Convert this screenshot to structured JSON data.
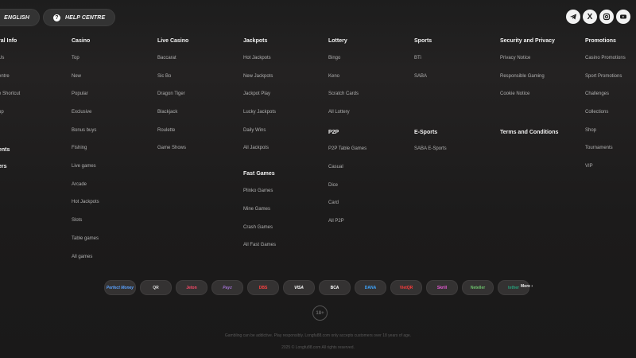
{
  "header": {
    "lang_label": "ENGLISH",
    "help_label": "HELP CENTRE",
    "social": [
      {
        "icon": "telegram-icon",
        "glyph": "➤"
      },
      {
        "icon": "x-icon",
        "glyph": "𝕏"
      },
      {
        "icon": "instagram-icon",
        "glyph": "◎"
      },
      {
        "icon": "youtube-icon",
        "glyph": "▶"
      }
    ]
  },
  "columns": [
    {
      "title": "ral Info",
      "sections": [
        {
          "items": [
            "Us",
            "entre",
            "e Shortcut",
            "op"
          ]
        },
        {
          "items": []
        }
      ],
      "extra_titles": [
        "ents",
        "ers"
      ]
    },
    {
      "title": "Casino",
      "items": [
        "Top",
        "New",
        "Popular",
        "Exclusive",
        "Bonus buys",
        "Fishing",
        "Live games",
        "Arcade",
        "Hot Jackpots",
        "Slots",
        "Table games",
        "All games"
      ]
    },
    {
      "title": "Live Casino",
      "items": [
        "Baccarat",
        "Sic Bo",
        "Dragon Tiger",
        "Blackjack",
        "Roulette",
        "Game Shows"
      ]
    },
    {
      "title": "Jackpots",
      "items": [
        "Hot Jackpots",
        "New Jackpots",
        "Jackpot Play",
        "Lucky Jackpots",
        "Daily Wins",
        "All Jackpots"
      ],
      "title2": "Fast Games",
      "items2": [
        "Plinko Games",
        "Mine Games",
        "Crash Games",
        "All Fast Games"
      ]
    },
    {
      "title": "Lottery",
      "items": [
        "Bingo",
        "Keno",
        "Scratch Cards",
        "All Lottery"
      ],
      "title2": "P2P",
      "items2": [
        "P2P Table Games",
        "Casual",
        "Dice",
        "Card",
        "All P2P"
      ]
    },
    {
      "title": "Sports",
      "items": [
        "BTi",
        "SABA"
      ],
      "title2": "E-Sports",
      "items2": [
        "SABA E-Sports"
      ]
    },
    {
      "title": "Security and Privacy",
      "items": [
        "Privacy Notice",
        "Responsible Gaming",
        "Cookie Notice"
      ],
      "title2": "Terms and Conditions",
      "items2": []
    },
    {
      "title": "Promotions",
      "items": [
        "Casino Promotions",
        "Sport Promotions",
        "Challenges",
        "Collections",
        "Shop",
        "Tournaments",
        "VIP"
      ]
    }
  ],
  "payments": [
    "Perfect Money",
    "QR",
    "Jeton",
    "Payz",
    "DBS",
    "VISA",
    "BCA",
    "DANA",
    "VietQR",
    "Skrill",
    "Neteller",
    "tether"
  ],
  "more_label": "More",
  "age_badge": "18+",
  "disclaimer": "Gambling can be addictive. Play responsibly. Longfu88.com only accepts customers over 18 years of age.",
  "copyright": "2025 © Longfu88.com All rights reserved."
}
